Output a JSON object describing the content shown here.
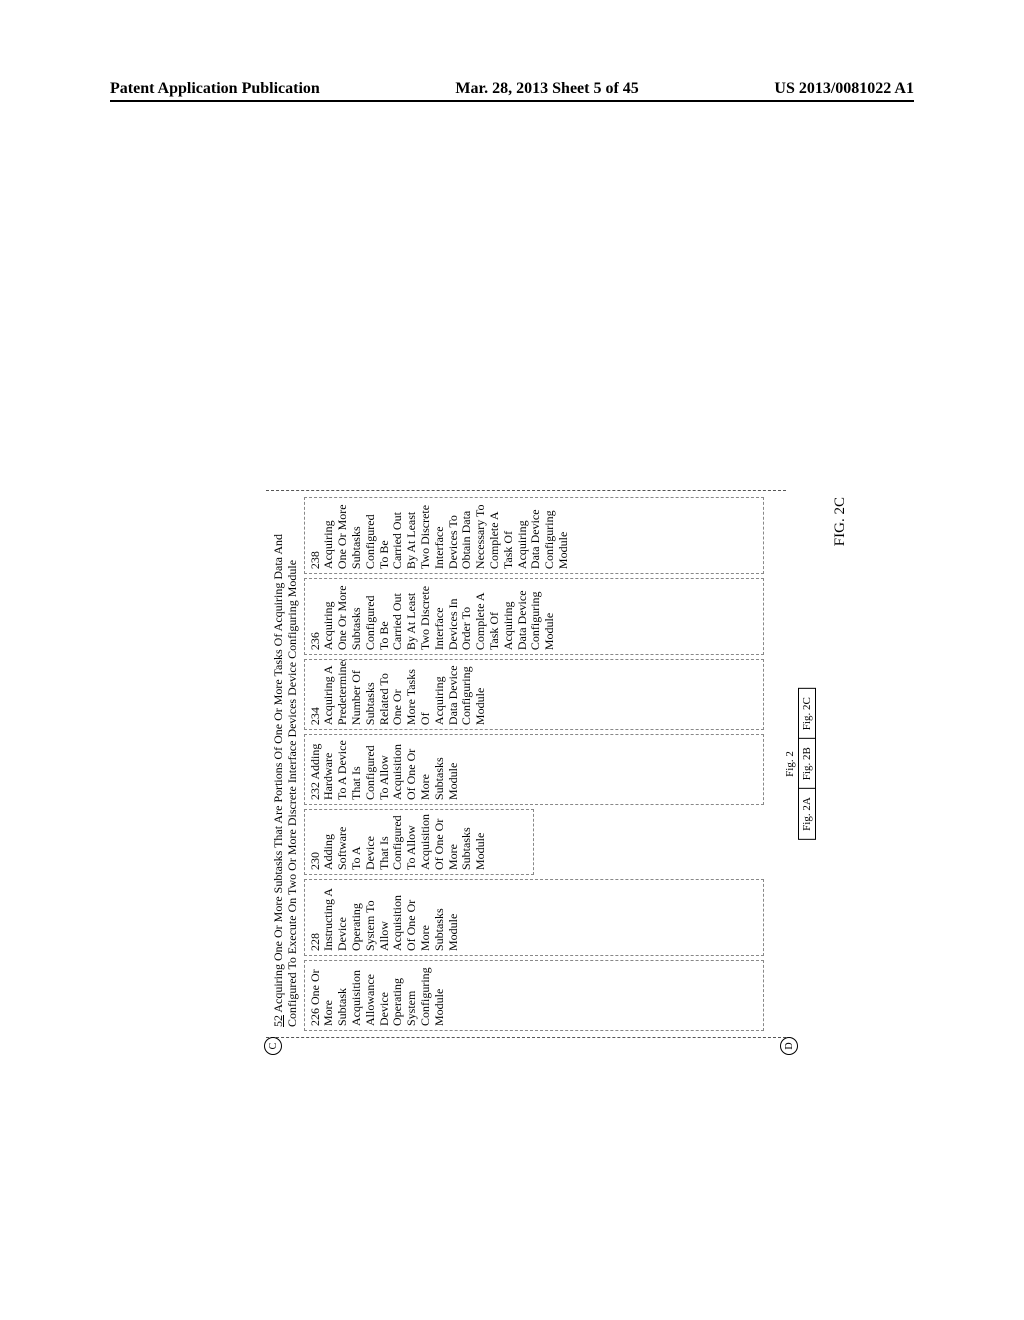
{
  "header": {
    "left": "Patent Application Publication",
    "center": "Mar. 28, 2013  Sheet 5 of 45",
    "right": "US 2013/0081022 A1"
  },
  "outer": {
    "ref": "52",
    "title": "Acquiring One Or More Subtasks That Are Portions Of One Or More Tasks Of Acquiring Data And Configured To Execute On Two Or More Discrete Interface Devices Device Configuring Module"
  },
  "connectors": {
    "top": "C",
    "bottom": "D"
  },
  "modules": [
    {
      "text": "226 One Or More Subtask Acquisition Allowance Device Operating System Configuring Module"
    },
    {
      "text": "228 Instructing A Device Operating System To Allow Acquisition Of One Or More Subtasks Module",
      "sub": [
        "230 Adding Software To A Device That Is Configured To Allow Acquisition Of One Or More Subtasks Module",
        "232 Adding Hardware To A Device That Is Configured To Allow Acquisition Of One Or More Subtasks Module"
      ]
    },
    {
      "text": "234 Acquiring A Predetermined Number Of Subtasks Related To One Or More Tasks Of Acquiring Data Device Configuring Module"
    },
    {
      "text": "236 Acquiring One Or More Subtasks Configured To Be Carried Out By At Least Two Discrete Interface Devices In Order To Complete A Task Of Acquiring Data Device Configuring Module"
    },
    {
      "text": "238 Acquiring One Or More Subtasks Configured To Be Carried Out By At Least Two Discrete Interface Devices To Obtain Data Necessary To Complete A Task Of Acquiring Data Device Configuring Module"
    }
  ],
  "legend": {
    "title": "Fig. 2",
    "items": [
      "Fig. 2A",
      "Fig. 2B",
      "Fig. 2C"
    ]
  },
  "figlabel": "FIG. 2C"
}
